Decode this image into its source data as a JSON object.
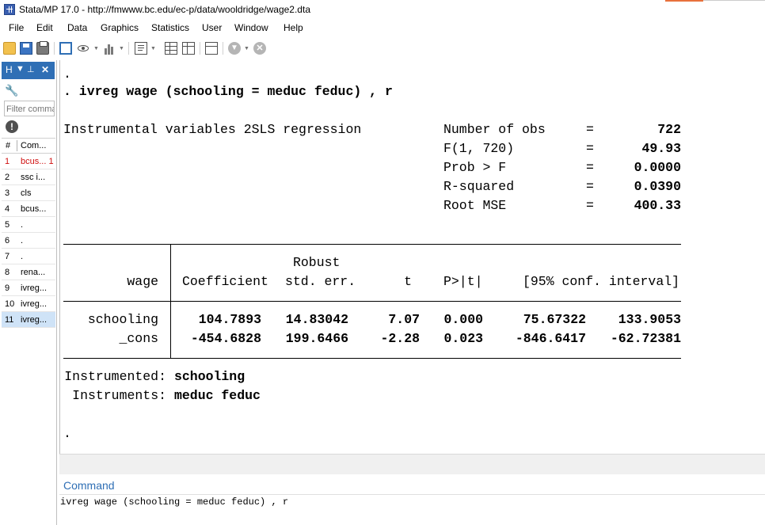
{
  "window": {
    "title": "Stata/MP 17.0 - http://fmwww.bc.edu/ec-p/data/wooldridge/wage2.dta"
  },
  "menu": [
    "File",
    "Edit",
    "Data",
    "Graphics",
    "Statistics",
    "User",
    "Window",
    "Help"
  ],
  "history": {
    "header_letter": "H",
    "filter_placeholder": "Filter commands",
    "col_num": "#",
    "col_cmd": "Com...",
    "rows": [
      {
        "n": "1",
        "cmd": "bcus...  1"
      },
      {
        "n": "2",
        "cmd": "ssc i..."
      },
      {
        "n": "3",
        "cmd": "cls"
      },
      {
        "n": "4",
        "cmd": "bcus..."
      },
      {
        "n": "5",
        "cmd": "."
      },
      {
        "n": "6",
        "cmd": "."
      },
      {
        "n": "7",
        "cmd": "."
      },
      {
        "n": "8",
        "cmd": "rena..."
      },
      {
        "n": "9",
        "cmd": "ivreg..."
      },
      {
        "n": "10",
        "cmd": "ivreg..."
      },
      {
        "n": "11",
        "cmd": "ivreg..."
      }
    ]
  },
  "results": {
    "dot_top": ".",
    "command_line": ". ivreg wage (schooling = meduc feduc) , r",
    "title": "Instrumental variables 2SLS regression",
    "stats": [
      {
        "label": "Number of obs",
        "eq": "=",
        "value": "722"
      },
      {
        "label": "F(1, 720)",
        "eq": "=",
        "value": "49.93"
      },
      {
        "label": "Prob > F",
        "eq": "=",
        "value": "0.0000"
      },
      {
        "label": "R-squared",
        "eq": "=",
        "value": "0.0390"
      },
      {
        "label": "Root MSE",
        "eq": "=",
        "value": "400.33"
      }
    ],
    "table": {
      "robust": "Robust",
      "depvar": "wage",
      "h_coef": "Coefficient",
      "h_se": "std. err.",
      "h_t": "t",
      "h_p": "P>|t|",
      "h_ci": "[95% conf. interval]",
      "rows": [
        {
          "var": "schooling",
          "coef": "104.7893",
          "se": "14.83042",
          "t": "7.07",
          "p": "0.000",
          "lo": "75.67322",
          "hi": "133.9053"
        },
        {
          "var": "_cons",
          "coef": "-454.6828",
          "se": "199.6466",
          "t": "-2.28",
          "p": "0.023",
          "lo": "-846.6417",
          "hi": "-62.72381"
        }
      ]
    },
    "instrumented_label": "Instrumented:",
    "instrumented_value": "schooling",
    "instruments_label": "Instruments:",
    "instruments_value": "meduc feduc",
    "dot_bottom": "."
  },
  "command": {
    "label": "Command",
    "value": "ivreg wage (schooling = meduc feduc) , r"
  },
  "colors": {
    "accent": "#2f6fb5",
    "history_error": "#d01010",
    "selected_row": "#cfe3f7"
  }
}
